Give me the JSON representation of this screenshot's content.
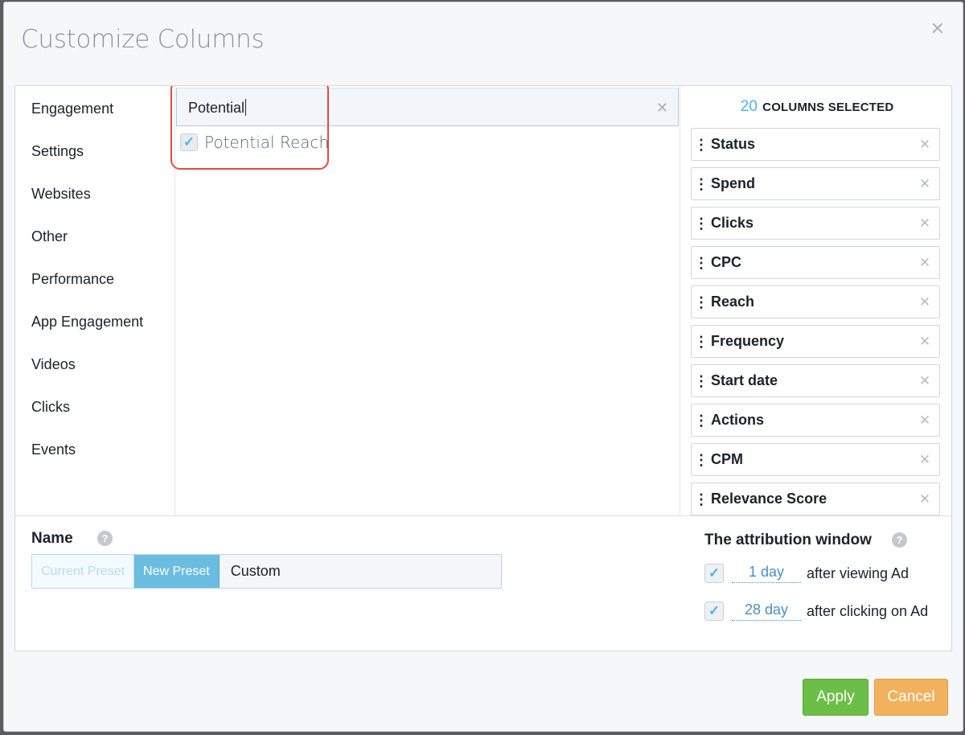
{
  "modal": {
    "title": "Customize Columns",
    "close_icon": "close-icon"
  },
  "categories": [
    "Engagement",
    "Settings",
    "Websites",
    "Other",
    "Performance",
    "App Engagement",
    "Videos",
    "Clicks",
    "Events"
  ],
  "search": {
    "value": "Potential",
    "clear_icon": "clear-icon"
  },
  "results": [
    {
      "label": "Potential Reach",
      "checked": true
    }
  ],
  "selected": {
    "count": "20",
    "header": "COLUMNS SELECTED",
    "items": [
      "Status",
      "Spend",
      "Clicks",
      "CPC",
      "Reach",
      "Frequency",
      "Start date",
      "Actions",
      "CPM",
      "Relevance Score"
    ]
  },
  "preset": {
    "name_label": "Name",
    "current_label": "Current Preset",
    "new_label": "New Preset",
    "name_value": "Custom"
  },
  "attribution": {
    "title": "The attribution window",
    "rows": [
      {
        "value": "1 day",
        "text": "after viewing Ad",
        "checked": true
      },
      {
        "value": "28 day",
        "text": "after clicking on Ad",
        "checked": true
      }
    ]
  },
  "actions": {
    "apply": "Apply",
    "cancel": "Cancel"
  },
  "colors": {
    "accent": "#4cb5e7",
    "apply": "#6bbf47",
    "cancel": "#f2b15c",
    "highlight": "#e34a44"
  }
}
